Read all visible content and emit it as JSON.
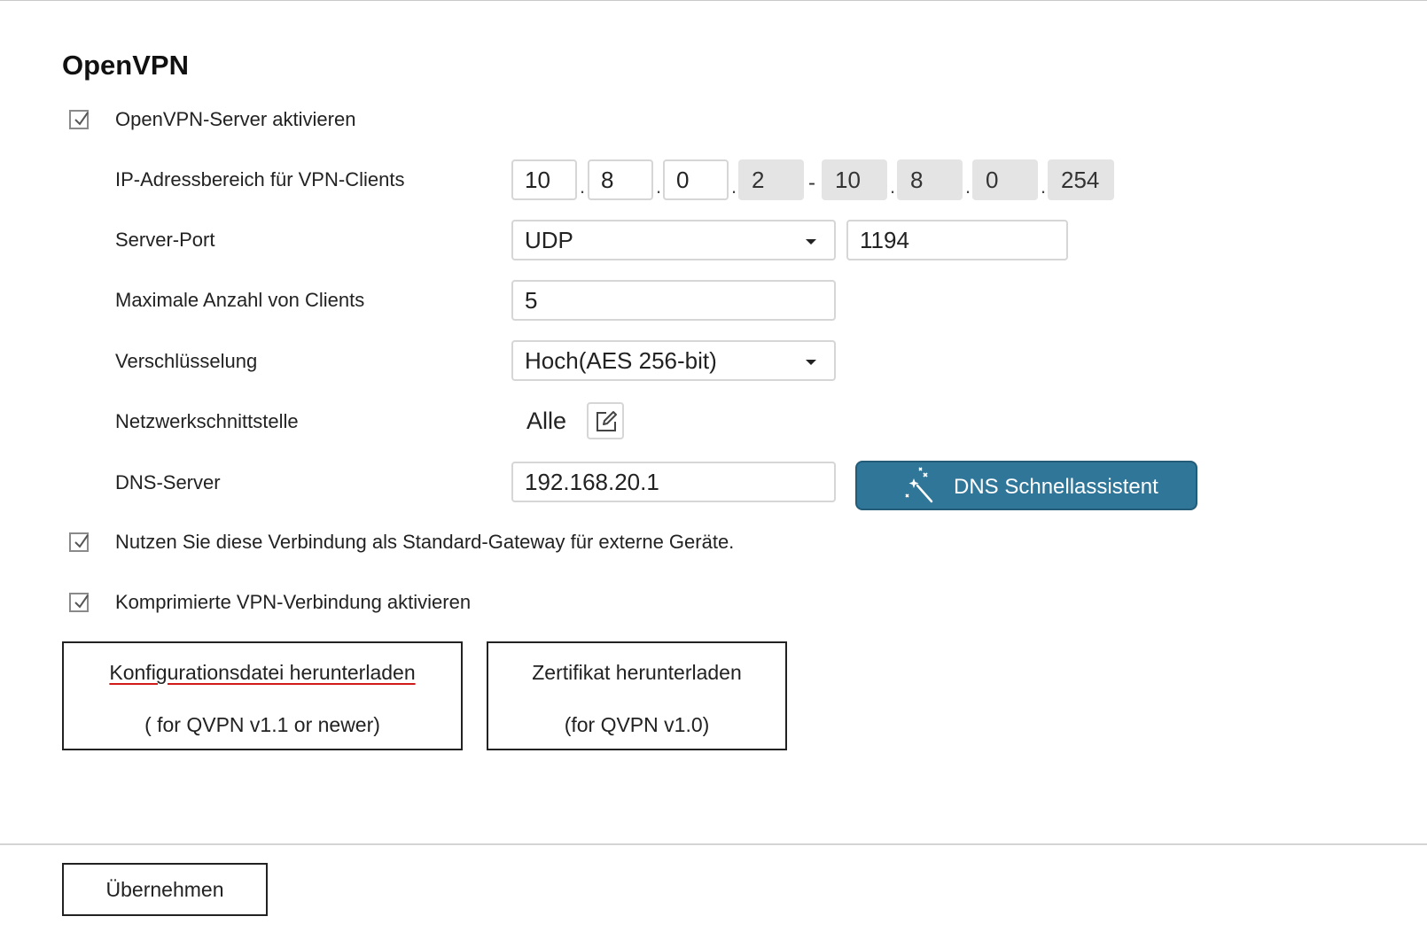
{
  "section_title": "OpenVPN",
  "enable_server": {
    "label": "OpenVPN-Server aktivieren",
    "checked": true
  },
  "ip_range": {
    "label": "IP-Adressbereich für VPN-Clients",
    "start": [
      "10",
      "8",
      "0",
      "2"
    ],
    "end": [
      "10",
      "8",
      "0",
      "254"
    ],
    "separator": "-"
  },
  "server_port": {
    "label": "Server-Port",
    "protocol": "UDP",
    "port": "1194"
  },
  "max_clients": {
    "label": "Maximale Anzahl von Clients",
    "value": "5"
  },
  "encryption": {
    "label": "Verschlüsselung",
    "value": "Hoch(AES 256-bit)"
  },
  "network_interface": {
    "label": "Netzwerkschnittstelle",
    "value": "Alle",
    "edit_icon": "edit-icon"
  },
  "dns_server": {
    "label": "DNS-Server",
    "value": "192.168.20.1",
    "wizard_button": "DNS Schnellassistent",
    "wizard_icon": "magic-wand-icon"
  },
  "default_gateway": {
    "label": "Nutzen Sie diese Verbindung als Standard-Gateway für externe Geräte.",
    "checked": true
  },
  "compression": {
    "label": "Komprimierte VPN-Verbindung aktivieren",
    "checked": true
  },
  "download_config": {
    "line1": "Konfigurationsdatei herunterladen",
    "line2": "( for QVPN v1.1 or newer)"
  },
  "download_cert": {
    "line1": "Zertifikat herunterladen",
    "line2": "(for QVPN v1.0)"
  },
  "apply_button": "Übernehmen",
  "colors": {
    "accent": "#2f7699",
    "disabled_field": "#e4e4e4",
    "field_border": "#d6d6d6",
    "spellcheck_underline": "#d11a1a"
  }
}
